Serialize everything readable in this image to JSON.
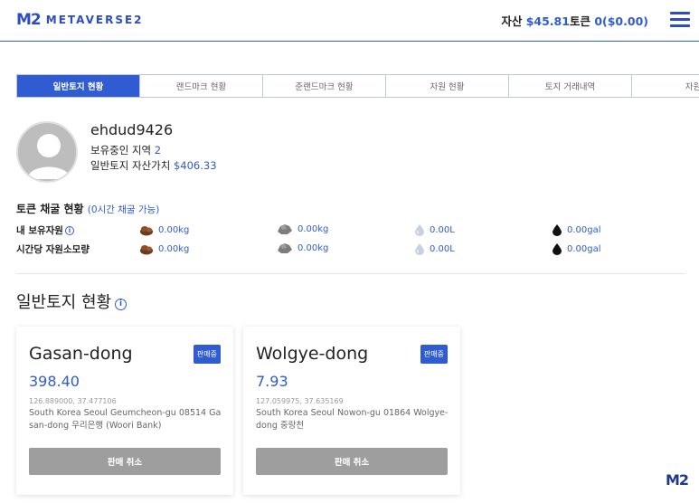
{
  "header": {
    "logo_mark": "M2",
    "logo_text": "METAVERSE2",
    "asset_label": "자산",
    "asset_value": "$45.81",
    "token_label": "토큰",
    "token_value": "0($0.00)"
  },
  "tabs": [
    {
      "label": "일반토지 현황",
      "active": true
    },
    {
      "label": "랜드마크 현황"
    },
    {
      "label": "준랜드마크 현황"
    },
    {
      "label": "자원 현황"
    },
    {
      "label": "토지 거래내역"
    },
    {
      "label": "자원"
    }
  ],
  "profile": {
    "username": "ehdud9426",
    "region_label": "보유중인 지역",
    "region_count": "2",
    "asset_label": "일반토지 자산가치",
    "asset_value": "$406.33"
  },
  "mining": {
    "title": "토큰 채굴 현황",
    "subtitle": "(0시간 채굴 가능)",
    "rows": [
      {
        "label": "내 보유자원",
        "values": [
          "0.00kg",
          "0.00kg",
          "0.00L",
          "0.00gal"
        ]
      },
      {
        "label": "시간당 자원소모량",
        "values": [
          "0.00kg",
          "0.00kg",
          "0.00L",
          "0.00gal"
        ]
      }
    ],
    "resource_icons": [
      "wood-icon",
      "stone-icon",
      "water-drop-icon",
      "oil-drop-icon"
    ]
  },
  "section": {
    "title": "일반토지 현황"
  },
  "cards": [
    {
      "name": "Gasan-dong",
      "badge": "판매중",
      "value": "398.40",
      "coord": "126.889000, 37.477106",
      "address": "South Korea Seoul Geumcheon-gu 08514 Gasan-dong 우리은행 (Woori Bank)",
      "button": "판매 취소"
    },
    {
      "name": "Wolgye-dong",
      "badge": "판매중",
      "value": "7.93",
      "coord": "127.059975, 37.635169",
      "address": "South Korea Seoul Nowon-gu 01864 Wolgye-dong 중랑천",
      "button": "판매 취소"
    }
  ],
  "corner_logo": "M2",
  "colors": {
    "accent": "#2f5bd3",
    "button_disabled": "#9e9e9e"
  }
}
